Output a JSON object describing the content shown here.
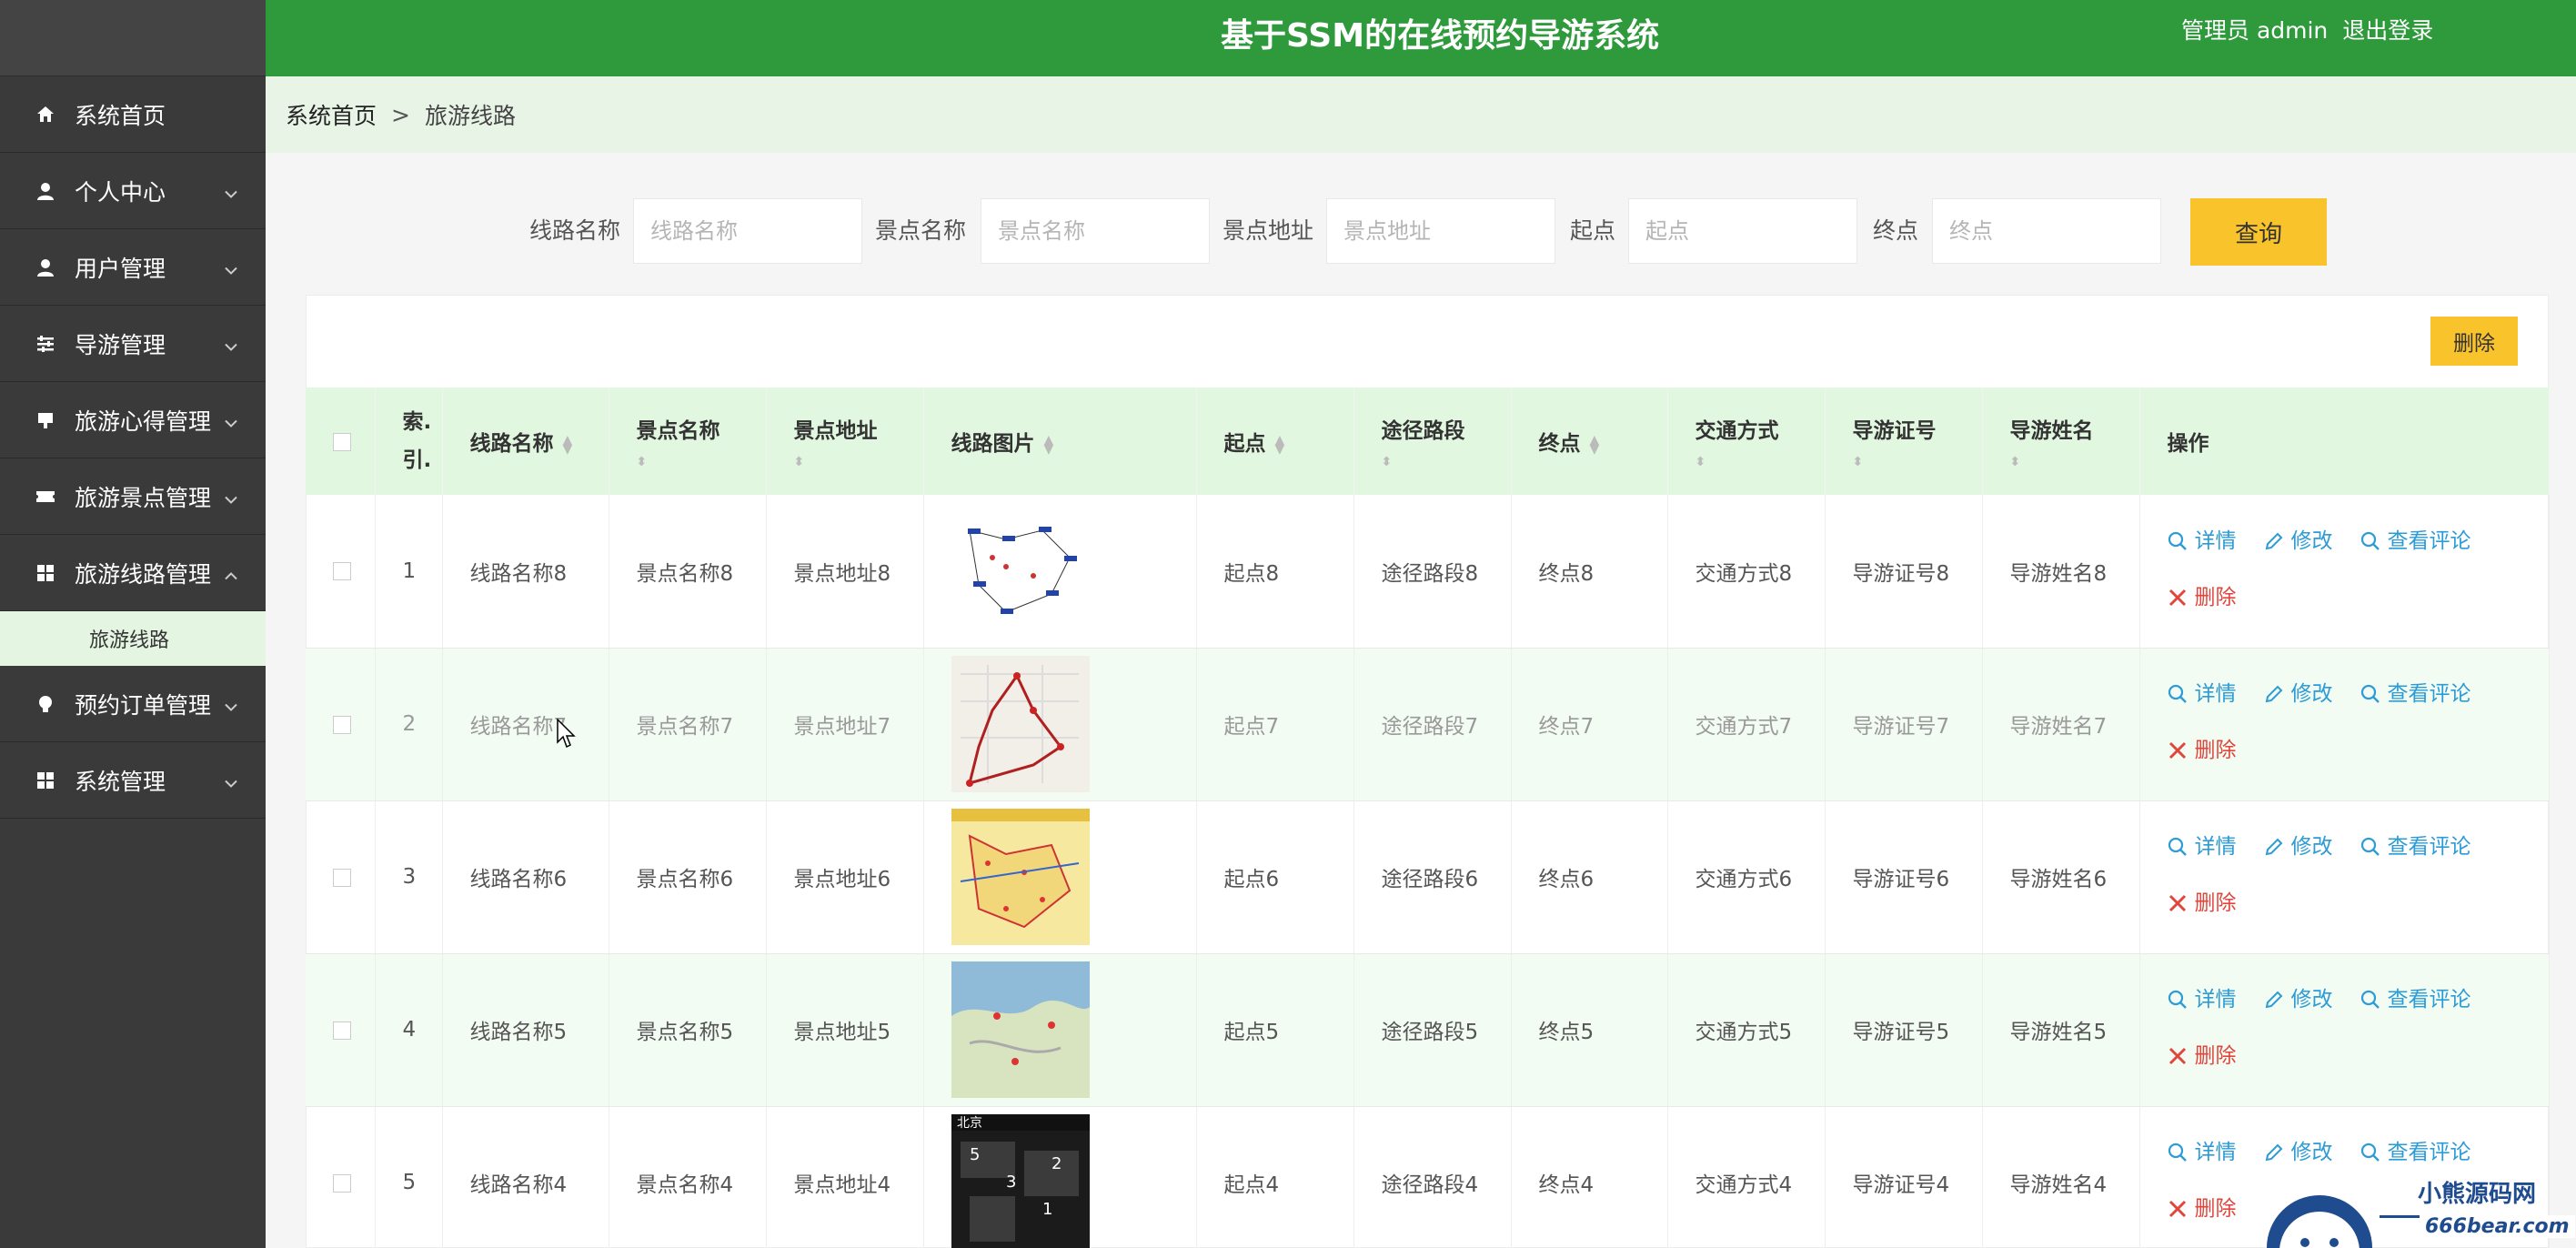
{
  "app": {
    "title": "基于SSM的在线预约导游系统",
    "user_label": "管理员 admin",
    "logout_label": "退出登录"
  },
  "sidebar": {
    "items": [
      {
        "label": "系统首页",
        "icon": "home-icon"
      },
      {
        "label": "个人中心",
        "icon": "user-icon"
      },
      {
        "label": "用户管理",
        "icon": "user-icon"
      },
      {
        "label": "导游管理",
        "icon": "sliders-icon"
      },
      {
        "label": "旅游心得管理",
        "icon": "note-icon"
      },
      {
        "label": "旅游景点管理",
        "icon": "ticket-icon"
      },
      {
        "label": "旅游线路管理",
        "icon": "grid-icon"
      },
      {
        "label": "预约订单管理",
        "icon": "bulb-icon"
      },
      {
        "label": "系统管理",
        "icon": "grid-icon"
      }
    ],
    "sub_active": "旅游线路"
  },
  "breadcrumb": {
    "home": "系统首页",
    "separator": ">",
    "current": "旅游线路"
  },
  "search": {
    "fields": [
      {
        "label": "线路名称",
        "placeholder": "线路名称"
      },
      {
        "label": "景点名称",
        "placeholder": "景点名称"
      },
      {
        "label": "景点地址",
        "placeholder": "景点地址"
      },
      {
        "label": "起点",
        "placeholder": "起点"
      },
      {
        "label": "终点",
        "placeholder": "终点"
      }
    ],
    "button": "查询"
  },
  "toolbar": {
    "delete_label": "删除"
  },
  "table": {
    "headers": [
      "索引",
      "线路名称",
      "景点名称",
      "景点地址",
      "线路图片",
      "起点",
      "途径路段",
      "终点",
      "交通方式",
      "导游证号",
      "导游姓名",
      "操作"
    ],
    "index_header_line1": "索.",
    "index_header_line2": "引.",
    "actions": {
      "detail": "详情",
      "edit": "修改",
      "review": "查看评论",
      "delete": "删除"
    },
    "rows": [
      {
        "index": "1",
        "route": "线路名称8",
        "spot": "景点名称8",
        "address": "景点地址8",
        "start": "起点8",
        "via": "途径路段8",
        "end": "终点8",
        "transport": "交通方式8",
        "license": "导游证号8",
        "guide": "导游姓名8"
      },
      {
        "index": "2",
        "route": "线路名称7",
        "spot": "景点名称7",
        "address": "景点地址7",
        "start": "起点7",
        "via": "途径路段7",
        "end": "终点7",
        "transport": "交通方式7",
        "license": "导游证号7",
        "guide": "导游姓名7"
      },
      {
        "index": "3",
        "route": "线路名称6",
        "spot": "景点名称6",
        "address": "景点地址6",
        "start": "起点6",
        "via": "途径路段6",
        "end": "终点6",
        "transport": "交通方式6",
        "license": "导游证号6",
        "guide": "导游姓名6"
      },
      {
        "index": "4",
        "route": "线路名称5",
        "spot": "景点名称5",
        "address": "景点地址5",
        "start": "起点5",
        "via": "途径路段5",
        "end": "终点5",
        "transport": "交通方式5",
        "license": "导游证号5",
        "guide": "导游姓名5"
      },
      {
        "index": "5",
        "route": "线路名称4",
        "spot": "景点名称4",
        "address": "景点地址4",
        "start": "起点4",
        "via": "途径路段4",
        "end": "终点4",
        "transport": "交通方式4",
        "license": "导游证号4",
        "guide": "导游姓名4"
      }
    ]
  },
  "watermark": {
    "title": "小熊源码网",
    "url": "666bear.com"
  },
  "colors": {
    "header": "#2e9a3c",
    "sidebar": "#3a3a3a",
    "accent_button": "#f9c32b",
    "table_header": "#e2f7df",
    "action_link": "#2c9bd6",
    "delete_link": "#e0463c"
  }
}
